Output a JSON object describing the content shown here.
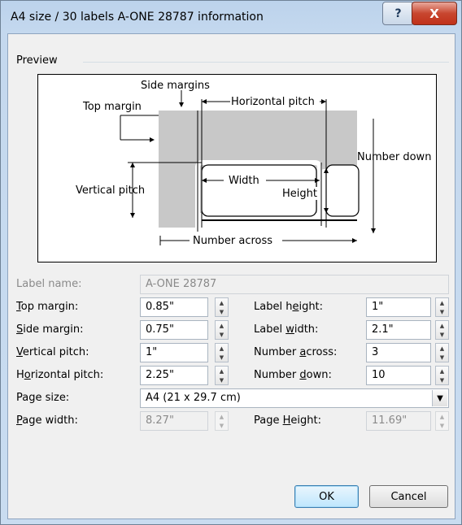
{
  "window": {
    "title": "A4 size / 30 labels A-ONE 28787 information",
    "help_glyph": "?",
    "close_glyph": "X"
  },
  "preview": {
    "group_label": "Preview",
    "diagram": {
      "side_margins": "Side margins",
      "top_margin": "Top margin",
      "horizontal_pitch": "Horizontal pitch",
      "number_down": "Number down",
      "width": "Width",
      "vertical_pitch": "Vertical pitch",
      "height": "Height",
      "number_across": "Number across"
    }
  },
  "form": {
    "label_name": {
      "label": "Label name:",
      "value": "A-ONE 28787"
    },
    "top_margin": {
      "label_pre": "",
      "label_u": "T",
      "label_post": "op margin:",
      "value": "0.85\""
    },
    "side_margin": {
      "label_pre": "",
      "label_u": "S",
      "label_post": "ide margin:",
      "value": "0.75\""
    },
    "vertical_pitch": {
      "label_pre": "",
      "label_u": "V",
      "label_post": "ertical pitch:",
      "value": "1\""
    },
    "horizontal_pitch": {
      "label_pre": "H",
      "label_u": "o",
      "label_post": "rizontal pitch:",
      "value": "2.25\""
    },
    "label_height": {
      "label_pre": "Label h",
      "label_u": "e",
      "label_post": "ight:",
      "value": "1\""
    },
    "label_width": {
      "label_pre": "Label ",
      "label_u": "w",
      "label_post": "idth:",
      "value": "2.1\""
    },
    "number_across": {
      "label_pre": "Number ",
      "label_u": "a",
      "label_post": "cross:",
      "value": "3"
    },
    "number_down": {
      "label_pre": "Number ",
      "label_u": "d",
      "label_post": "own:",
      "value": "10"
    },
    "page_size": {
      "label": "Page size:",
      "value": "A4 (21 x 29.7 cm)"
    },
    "page_width": {
      "label_pre": "",
      "label_u": "P",
      "label_post": "age width:",
      "value": "8.27\""
    },
    "page_height": {
      "label_pre": "Page ",
      "label_u": "H",
      "label_post": "eight:",
      "value": "11.69\""
    }
  },
  "buttons": {
    "ok": "OK",
    "cancel": "Cancel"
  },
  "icons": {
    "spin_up": "▲",
    "spin_down": "▼",
    "dropdown": "▼"
  }
}
